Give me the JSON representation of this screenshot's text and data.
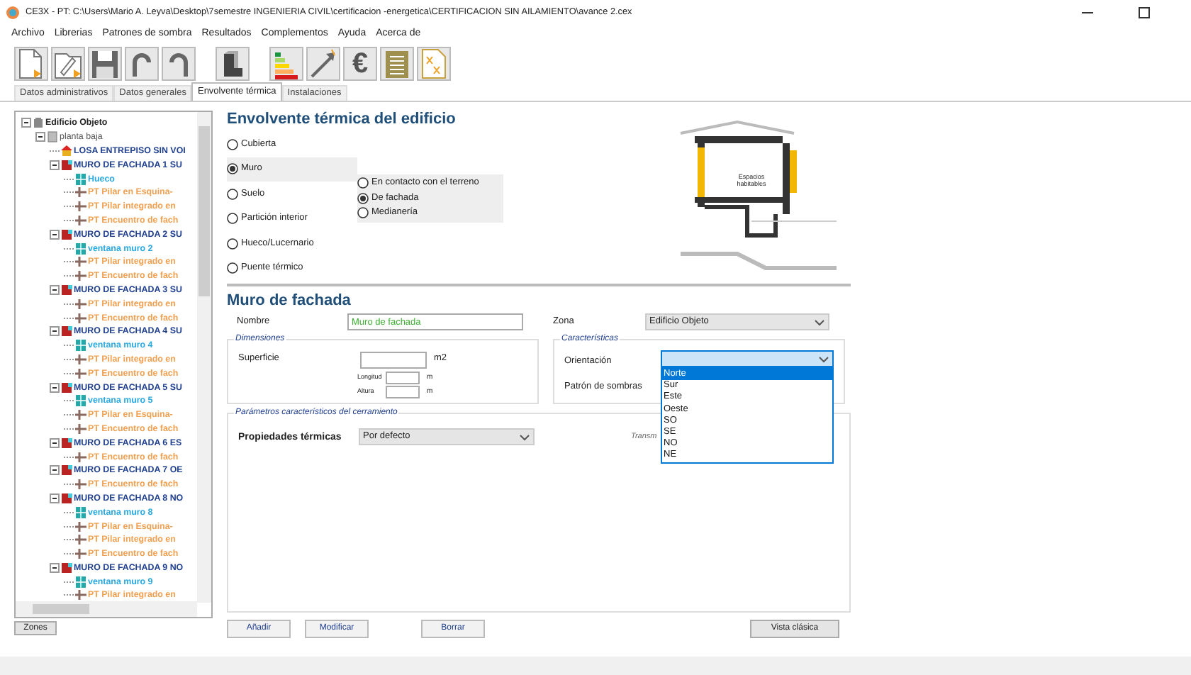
{
  "window": {
    "title": "CE3X - PT: C:\\Users\\Mario A. Leyva\\Desktop\\7semestre INGENIERIA CIVIL\\certificacion -energetica\\CERTIFICACION SIN AILAMIENTO\\avance 2.cex"
  },
  "menu": [
    "Archivo",
    "Librerias",
    "Patrones de sombra",
    "Resultados",
    "Complementos",
    "Ayuda",
    "Acerca de"
  ],
  "toolbar": [
    {
      "kind": "new"
    },
    {
      "kind": "open"
    },
    {
      "kind": "save"
    },
    {
      "kind": "undo"
    },
    {
      "kind": "redo"
    },
    {
      "kind": "gap"
    },
    {
      "kind": "solid"
    },
    {
      "kind": "gap"
    },
    {
      "kind": "rating"
    },
    {
      "kind": "improve"
    },
    {
      "kind": "euro",
      "glyph": "€"
    },
    {
      "kind": "report"
    },
    {
      "kind": "export"
    }
  ],
  "tabs": [
    {
      "label": "Datos administrativos",
      "selected": false
    },
    {
      "label": "Datos generales",
      "selected": false
    },
    {
      "label": "Envolvente térmica",
      "selected": true
    },
    {
      "label": "Instalaciones",
      "selected": false
    }
  ],
  "tree": [
    {
      "label": "Edificio Objeto",
      "kind": "building",
      "expanded": true,
      "children": [
        {
          "label": "planta baja",
          "kind": "floor",
          "expanded": true,
          "children": [
            {
              "label": "LOSA ENTREPISO SIN VOI",
              "kind": "slab"
            },
            {
              "label": "MURO DE FACHADA 1 SU",
              "kind": "wall",
              "expanded": true,
              "children": [
                {
                  "label": "Hueco",
                  "kind": "window"
                },
                {
                  "label": "PT Pilar en Esquina-",
                  "kind": "bridge"
                },
                {
                  "label": "PT Pilar integrado en",
                  "kind": "bridge"
                },
                {
                  "label": "PT Encuentro de fach",
                  "kind": "bridge"
                }
              ]
            },
            {
              "label": "MURO DE FACHADA 2 SU",
              "kind": "wall",
              "expanded": true,
              "children": [
                {
                  "label": "ventana muro 2",
                  "kind": "window"
                },
                {
                  "label": "PT Pilar integrado en",
                  "kind": "bridge"
                },
                {
                  "label": "PT Encuentro de fach",
                  "kind": "bridge"
                }
              ]
            },
            {
              "label": "MURO DE FACHADA 3 SU",
              "kind": "wall",
              "expanded": true,
              "children": [
                {
                  "label": "PT Pilar integrado en",
                  "kind": "bridge"
                },
                {
                  "label": "PT Encuentro de fach",
                  "kind": "bridge"
                }
              ]
            },
            {
              "label": "MURO DE FACHADA 4 SU",
              "kind": "wall",
              "expanded": true,
              "children": [
                {
                  "label": "ventana muro 4",
                  "kind": "window"
                },
                {
                  "label": "PT Pilar integrado en",
                  "kind": "bridge"
                },
                {
                  "label": "PT Encuentro de fach",
                  "kind": "bridge"
                }
              ]
            },
            {
              "label": "MURO DE FACHADA 5 SU",
              "kind": "wall",
              "expanded": true,
              "children": [
                {
                  "label": "ventana muro 5",
                  "kind": "window"
                },
                {
                  "label": "PT Pilar en Esquina-",
                  "kind": "bridge"
                },
                {
                  "label": "PT Encuentro de fach",
                  "kind": "bridge"
                }
              ]
            },
            {
              "label": "MURO DE FACHADA 6 ES",
              "kind": "wall",
              "expanded": true,
              "children": [
                {
                  "label": "PT Encuentro de fach",
                  "kind": "bridge"
                }
              ]
            },
            {
              "label": "MURO DE FACHADA 7 OE",
              "kind": "wall",
              "expanded": true,
              "children": [
                {
                  "label": "PT Encuentro de fach",
                  "kind": "bridge"
                }
              ]
            },
            {
              "label": "MURO DE FACHADA 8 NO",
              "kind": "wall",
              "expanded": true,
              "children": [
                {
                  "label": "ventana muro 8",
                  "kind": "window"
                },
                {
                  "label": "PT Pilar en Esquina-",
                  "kind": "bridge"
                },
                {
                  "label": "PT Pilar integrado en",
                  "kind": "bridge"
                },
                {
                  "label": "PT Encuentro de fach",
                  "kind": "bridge"
                }
              ]
            },
            {
              "label": "MURO DE FACHADA 9 NO",
              "kind": "wall",
              "expanded": true,
              "children": [
                {
                  "label": "ventana muro 9",
                  "kind": "window"
                },
                {
                  "label": "PT Pilar integrado en",
                  "kind": "bridge"
                }
              ]
            }
          ]
        }
      ]
    }
  ],
  "zones_button": "Zones",
  "heading": "Envolvente térmica del edificio",
  "element_types": [
    {
      "label": "Cubierta",
      "selected": false
    },
    {
      "label": "Muro",
      "selected": true
    },
    {
      "label": "Suelo",
      "selected": false
    },
    {
      "label": "Partición interior",
      "selected": false
    },
    {
      "label": "Hueco/Lucernario",
      "selected": false
    },
    {
      "label": "Puente térmico",
      "selected": false
    }
  ],
  "wall_types": [
    {
      "label": "En contacto con el terreno",
      "selected": false
    },
    {
      "label": "De fachada",
      "selected": true
    },
    {
      "label": "Medianería",
      "selected": false
    }
  ],
  "diagram_label": "Espacios habitables",
  "form_title": "Muro de fachada",
  "nombre": {
    "label": "Nombre",
    "value": "Muro de fachada"
  },
  "zona": {
    "label": "Zona",
    "value": "Edificio Objeto"
  },
  "dimensiones": {
    "title": "Dimensiones",
    "superficie": "Superficie",
    "superficie_unit": "m2",
    "longitud": "Longitud",
    "longitud_unit": "m",
    "altura": "Altura",
    "altura_unit": "m"
  },
  "caracteristicas": {
    "title": "Características",
    "orientacion": "Orientación",
    "patron": "Patrón de sombras",
    "options": [
      {
        "label": "Norte",
        "selected": true
      },
      {
        "label": "Sur",
        "selected": false
      },
      {
        "label": "Este",
        "selected": false
      },
      {
        "label": "Oeste",
        "selected": false
      },
      {
        "label": "SO",
        "selected": false
      },
      {
        "label": "SE",
        "selected": false
      },
      {
        "label": "NO",
        "selected": false
      },
      {
        "label": "NE",
        "selected": false
      }
    ]
  },
  "parametros": {
    "title": "Parámetros característicos del cerramiento",
    "label": "Propiedades térmicas",
    "value": "Por defecto",
    "column_3": "Transm"
  },
  "buttons": [
    "Añadir",
    "Modificar",
    "Borrar"
  ],
  "classic_view_button": "Vista clásica"
}
